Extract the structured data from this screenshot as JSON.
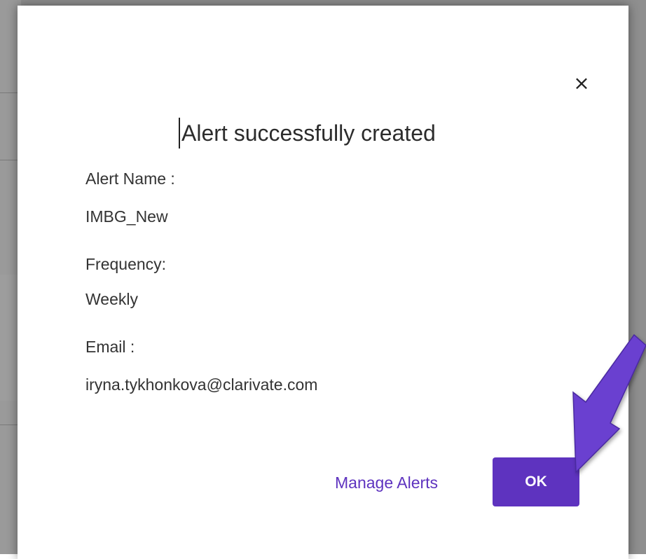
{
  "modal": {
    "close_icon": "×",
    "title": "Alert successfully created",
    "fields": [
      {
        "label": "Alert Name :",
        "value": "IMBG_New"
      },
      {
        "label": "Frequency:",
        "value": "Weekly"
      },
      {
        "label": "Email :",
        "value": "iryna.tykhonkova@clarivate.com"
      }
    ],
    "manage_alerts_label": "Manage Alerts",
    "ok_label": "OK"
  },
  "colors": {
    "accent": "#5e33bf",
    "arrow": "#6b3fd0"
  },
  "icons": [
    "close-icon",
    "annotation-arrow"
  ]
}
